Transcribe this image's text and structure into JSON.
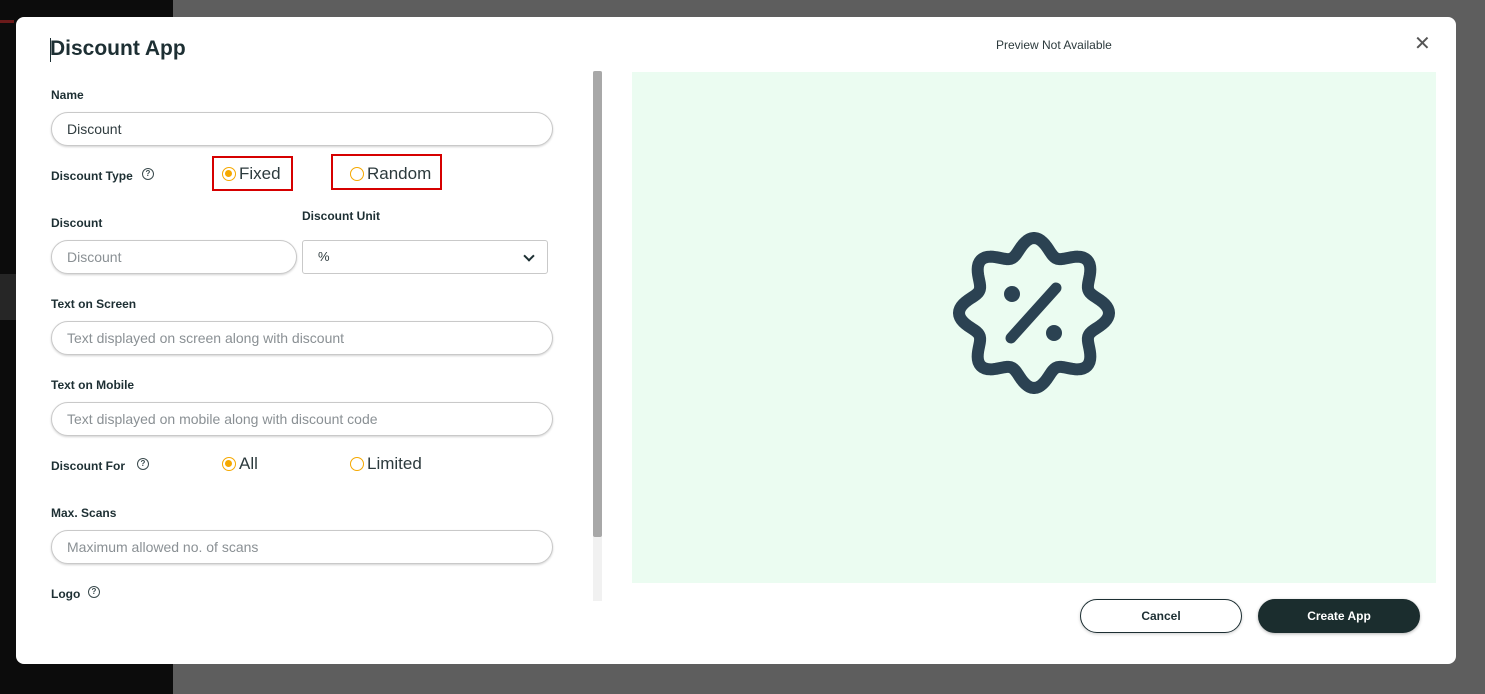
{
  "modal": {
    "title": "Discount App",
    "preview_title": "Preview Not Available",
    "close_glyph": "✕"
  },
  "form": {
    "name": {
      "label": "Name",
      "value": "Discount"
    },
    "discount_type": {
      "label": "Discount Type",
      "options": [
        "Fixed",
        "Random"
      ],
      "selected": "Fixed"
    },
    "discount": {
      "label": "Discount",
      "placeholder": "Discount"
    },
    "discount_unit": {
      "label": "Discount Unit",
      "value": "%"
    },
    "text_on_screen": {
      "label": "Text on Screen",
      "placeholder": "Text displayed on screen along with discount"
    },
    "text_on_mobile": {
      "label": "Text on Mobile",
      "placeholder": "Text displayed on mobile along with discount code"
    },
    "discount_for": {
      "label": "Discount For",
      "options": [
        "All",
        "Limited"
      ],
      "selected": "All"
    },
    "max_scans": {
      "label": "Max. Scans",
      "placeholder": "Maximum allowed no. of scans"
    },
    "logo": {
      "label": "Logo"
    }
  },
  "actions": {
    "cancel": "Cancel",
    "create": "Create App"
  },
  "icons": {
    "help": "question-circle-icon",
    "preview": "discount-badge-icon",
    "dropdown": "chevron-down-icon"
  },
  "colors": {
    "accent": "#f5a800",
    "primary": "#1b2d2e",
    "preview_bg": "#ebfcf1",
    "highlight": "#d60000"
  }
}
